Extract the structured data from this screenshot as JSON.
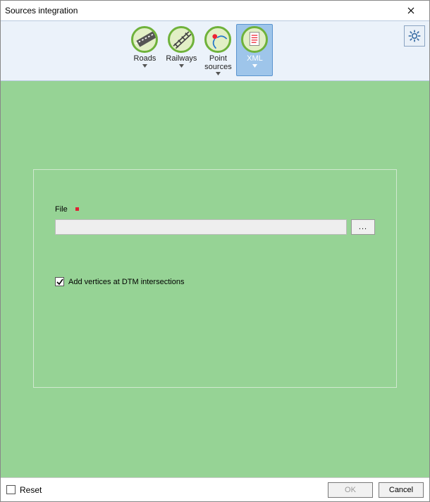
{
  "window": {
    "title": "Sources integration"
  },
  "toolbar": {
    "items": [
      {
        "label": "Roads"
      },
      {
        "label": "Railways"
      },
      {
        "label": "Point sources"
      },
      {
        "label": "XML"
      }
    ]
  },
  "form": {
    "file_label": "File",
    "file_value": "",
    "browse_label": "...",
    "dtm_checkbox_label": "Add vertices at DTM intersections",
    "dtm_checkbox_checked": true
  },
  "footer": {
    "reset_label": "Reset",
    "reset_checked": false,
    "ok_label": "OK",
    "cancel_label": "Cancel"
  }
}
